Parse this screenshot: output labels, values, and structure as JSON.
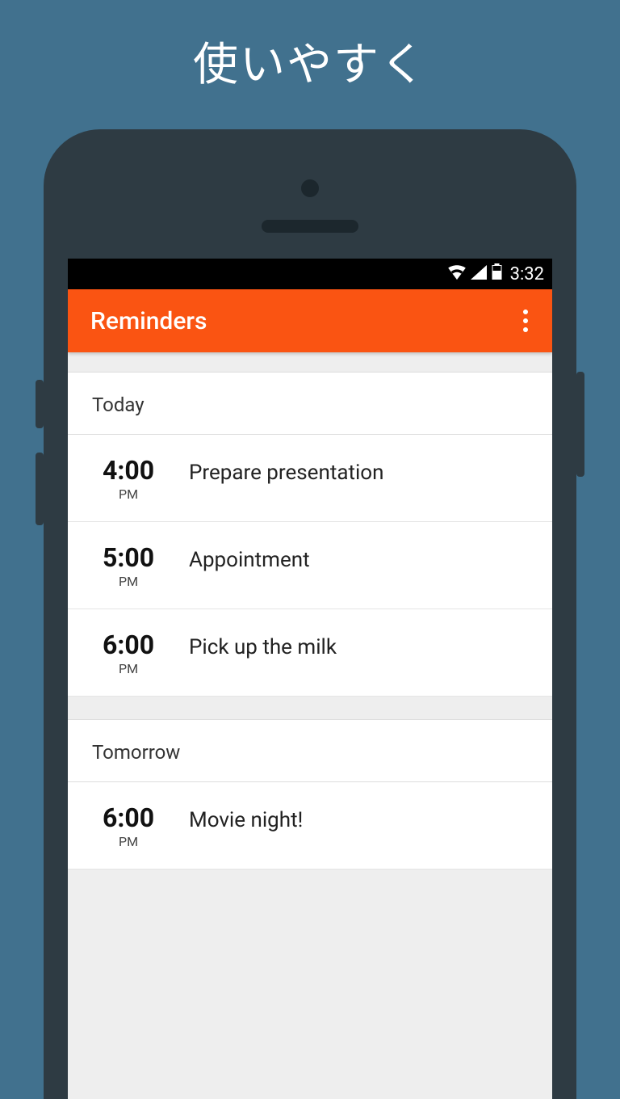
{
  "promo": {
    "title": "使いやすく"
  },
  "statusbar": {
    "time": "3:32"
  },
  "appbar": {
    "title": "Reminders"
  },
  "sections": [
    {
      "label": "Today",
      "items": [
        {
          "time": "4:00",
          "meridiem": "PM",
          "title": "Prepare presentation"
        },
        {
          "time": "5:00",
          "meridiem": "PM",
          "title": "Appointment"
        },
        {
          "time": "6:00",
          "meridiem": "PM",
          "title": "Pick up the milk"
        }
      ]
    },
    {
      "label": "Tomorrow",
      "items": [
        {
          "time": "6:00",
          "meridiem": "PM",
          "title": "Movie night!"
        }
      ]
    }
  ],
  "colors": {
    "accent": "#fa5412",
    "bg": "#41718e",
    "phone": "#2e3b43"
  }
}
